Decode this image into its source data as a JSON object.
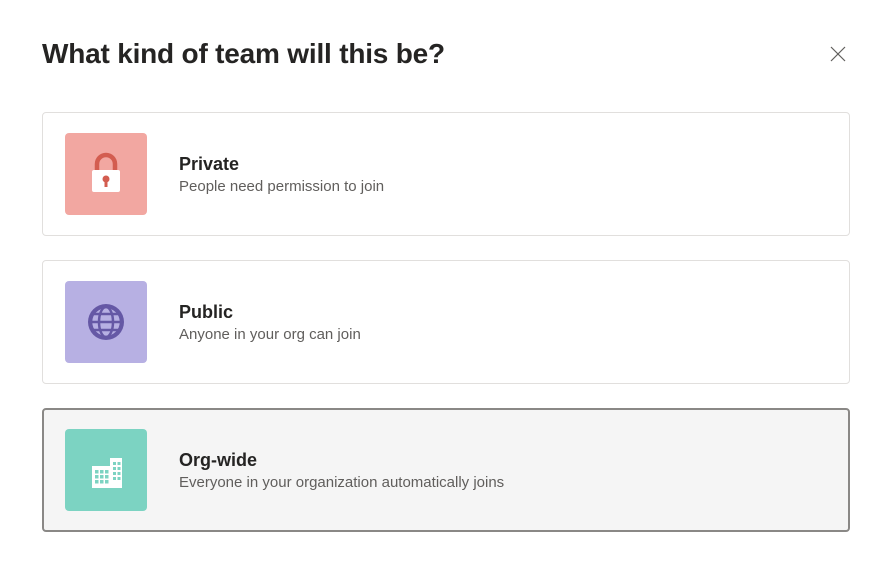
{
  "dialog": {
    "title": "What kind of team will this be?"
  },
  "options": [
    {
      "title": "Private",
      "description": "People need permission to join"
    },
    {
      "title": "Public",
      "description": "Anyone in your org can join"
    },
    {
      "title": "Org-wide",
      "description": "Everyone in your organization automatically joins"
    }
  ]
}
